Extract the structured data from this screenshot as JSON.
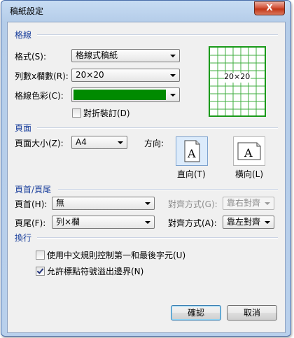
{
  "window": {
    "title": "稿紙設定",
    "close_label": "X"
  },
  "sections": {
    "grid": "格線",
    "page": "頁面",
    "header_footer": "頁首/頁尾",
    "line_break": "換行"
  },
  "grid": {
    "format_label": "格式(S):",
    "format_value": "格線式稿紙",
    "size_label": "列數x欄數(R):",
    "size_value": "20×20",
    "color_label": "格線色彩(C):",
    "color_value": "#008a00",
    "fold_label": "對折裝訂(D)",
    "fold_checked": false,
    "preview_label": "20×20"
  },
  "page": {
    "size_label": "頁面大小(Z):",
    "size_value": "A4",
    "orientation_label": "方向:",
    "portrait_label": "直向(T)",
    "landscape_label": "橫向(L)",
    "orientation_selected": "portrait"
  },
  "header_footer": {
    "header_label": "頁首(H):",
    "header_value": "無",
    "header_align_label": "對齊方式(G):",
    "header_align_value": "靠右對齊",
    "footer_label": "頁尾(F):",
    "footer_value": "列×欄",
    "footer_align_label": "對齊方式(A):",
    "footer_align_value": "靠左對齊"
  },
  "line_break": {
    "rule_label": "使用中文規則控制第一和最後字元(U)",
    "rule_checked": false,
    "overflow_label": "允許標點符號溢出邊界(N)",
    "overflow_checked": true
  },
  "buttons": {
    "ok": "確認",
    "cancel": "取消"
  }
}
